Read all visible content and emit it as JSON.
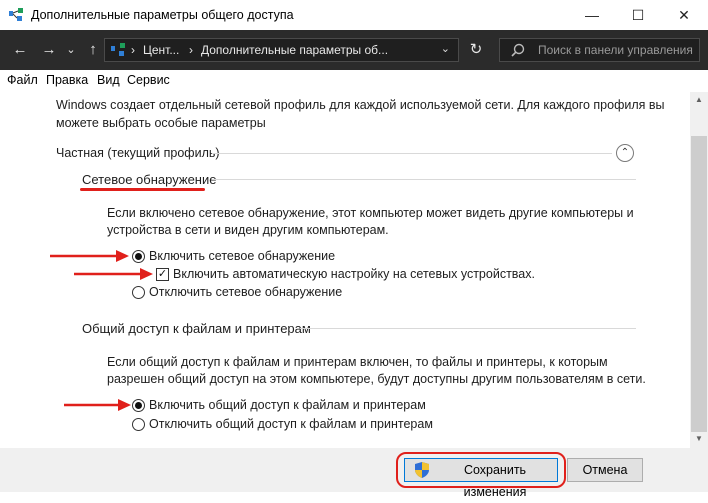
{
  "window": {
    "title": "Дополнительные параметры общего доступа",
    "minimize": "—",
    "maximize": "☐",
    "close": "✕"
  },
  "nav": {
    "back": "←",
    "forward": "→",
    "recent": "⌄",
    "up": "↑",
    "address_segments": [
      "Цент...",
      "Дополнительные параметры об..."
    ],
    "separator": "›",
    "dropdown": "⌄",
    "refresh": "↻",
    "search_placeholder": "Поиск в панели управления"
  },
  "menu": [
    "Файл",
    "Правка",
    "Вид",
    "Сервис"
  ],
  "content": {
    "intro_line1": "Windows создает отдельный сетевой профиль для каждой используемой сети. Для каждого профиля вы",
    "intro_line2": "можете выбрать особые параметры",
    "profile_header": "Частная (текущий профиль)",
    "collapse_glyph": "⌃",
    "discovery": {
      "title": "Сетевое обнаружение",
      "desc_line1": "Если включено сетевое обнаружение, этот компьютер может видеть другие компьютеры и",
      "desc_line2": "устройства в сети и виден другим компьютерам.",
      "opt_on": "Включить сетевое обнаружение",
      "opt_auto": "Включить автоматическую настройку на сетевых устройствах.",
      "opt_off": "Отключить сетевое обнаружение",
      "selected": "on",
      "auto_checked": true
    },
    "sharing": {
      "title": "Общий доступ к файлам и принтерам",
      "desc_line1": "Если общий доступ к файлам и принтерам включен, то файлы и принтеры, к которым",
      "desc_line2": "разрешен общий доступ на этом компьютере, будут доступны другим пользователям в сети.",
      "opt_on": "Включить общий доступ к файлам и принтерам",
      "opt_off": "Отключить общий доступ к файлам и принтерам",
      "selected": "on"
    }
  },
  "footer": {
    "save": "Сохранить изменения",
    "cancel": "Отмена"
  },
  "colors": {
    "annotation": "#e0201b",
    "nav_background": "#2b2b2b",
    "accent": "#0078d7"
  },
  "icons": [
    "network-icon",
    "search-icon",
    "shield-icon"
  ]
}
